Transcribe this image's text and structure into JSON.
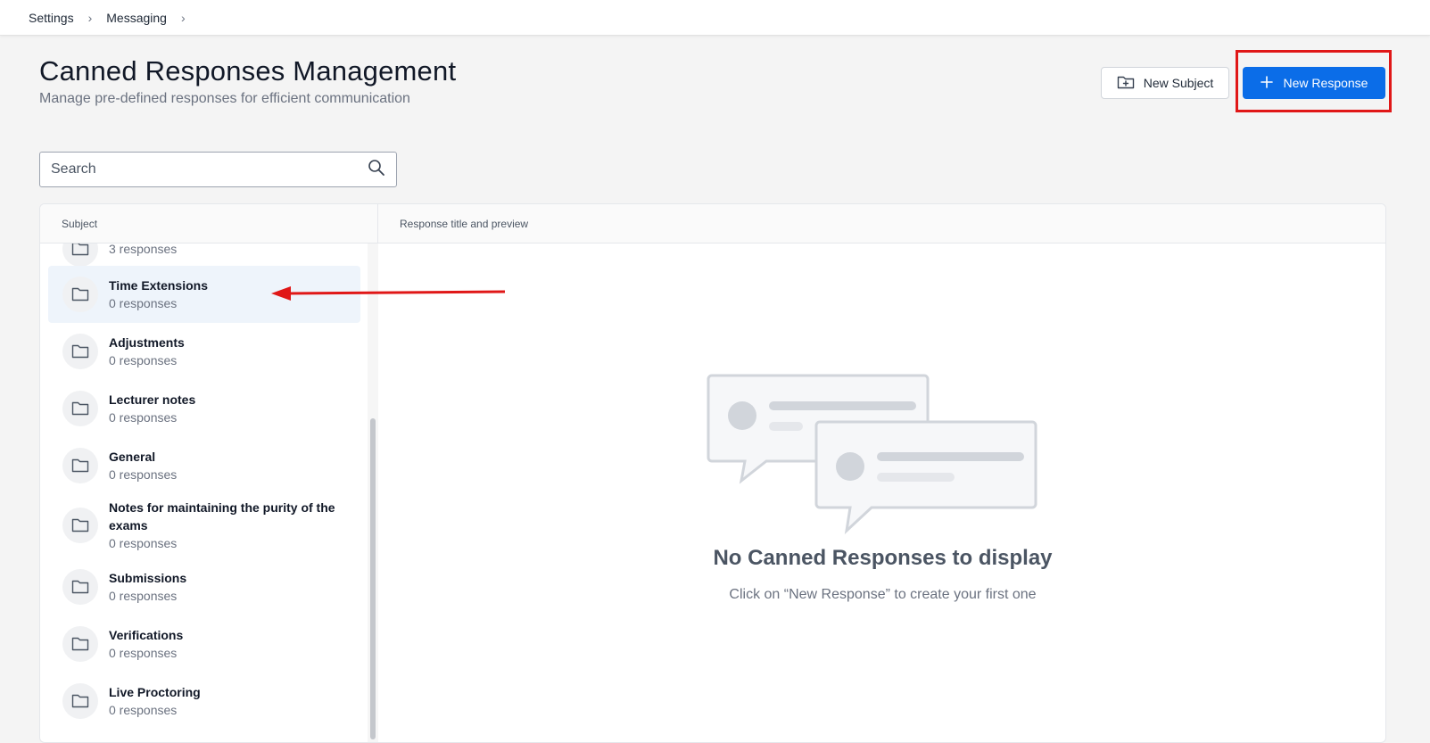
{
  "breadcrumb": {
    "items": [
      "Settings",
      "Messaging"
    ],
    "separator": "›"
  },
  "header": {
    "title": "Canned Responses Management",
    "subtitle": "Manage pre-defined responses for efficient communication"
  },
  "actions": {
    "new_subject_label": "New Subject",
    "new_subject_icon": "folder-plus-icon",
    "new_response_label": "New Response",
    "new_response_icon": "plus-icon",
    "new_response_color": "#0b6de8"
  },
  "search": {
    "placeholder": "Search",
    "value": "",
    "icon": "search-icon"
  },
  "table": {
    "subject_header": "Subject",
    "response_header": "Response title and preview"
  },
  "subjects": [
    {
      "name": "",
      "count": "3 responses"
    },
    {
      "name": "Time Extensions",
      "count": "0 responses",
      "active": true
    },
    {
      "name": "Adjustments",
      "count": "0 responses"
    },
    {
      "name": "Lecturer notes",
      "count": "0 responses"
    },
    {
      "name": "General",
      "count": "0 responses"
    },
    {
      "name": "Notes for maintaining the purity of the exams",
      "count": "0 responses"
    },
    {
      "name": "Submissions",
      "count": "0 responses"
    },
    {
      "name": "Verifications",
      "count": "0 responses"
    },
    {
      "name": "Live Proctoring",
      "count": "0 responses"
    }
  ],
  "empty_state": {
    "title": "No Canned Responses to display",
    "message": "Click on “New Response” to create your first one",
    "icon": "chat-bubbles-icon"
  },
  "annotation_color": "#e01717"
}
